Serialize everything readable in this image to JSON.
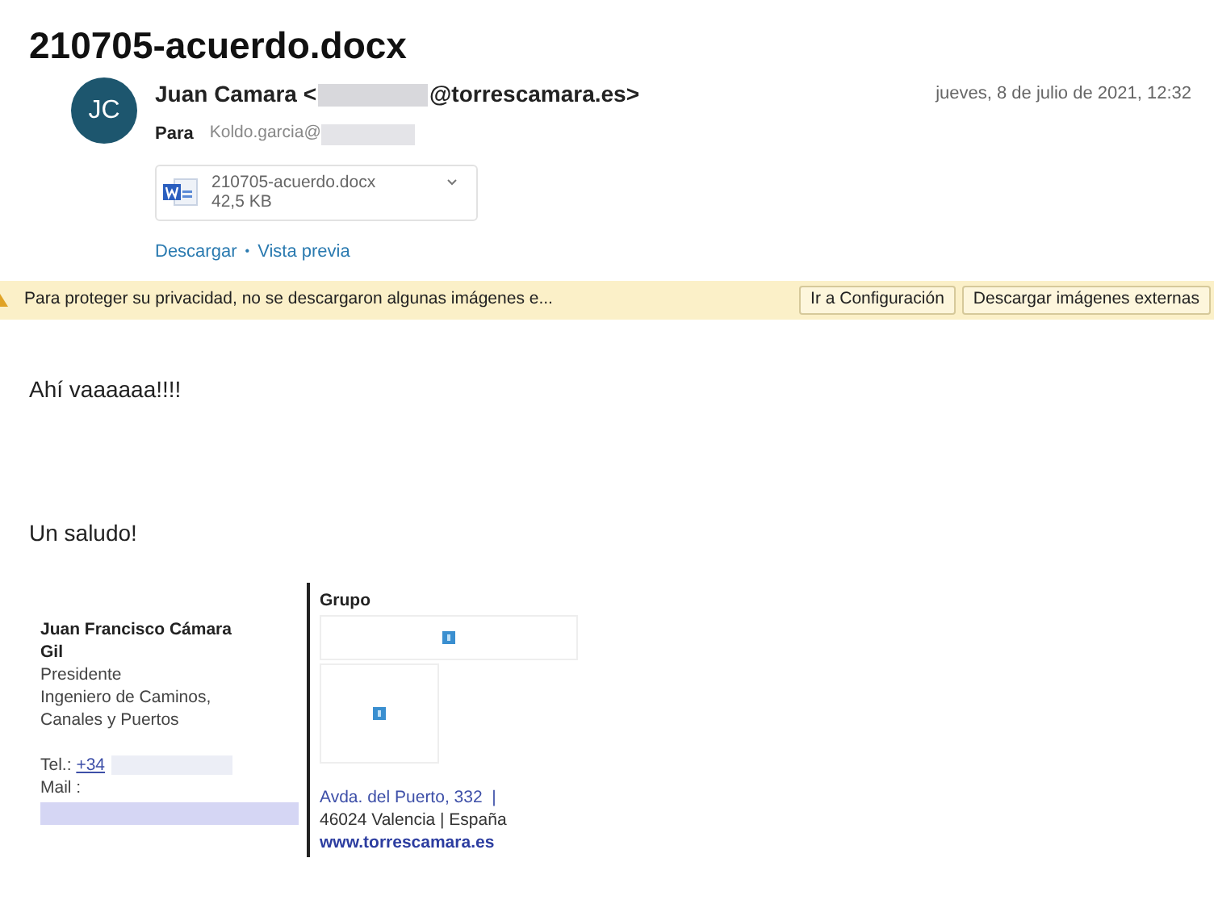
{
  "title": "210705-acuerdo.docx",
  "sender": {
    "initials": "JC",
    "name": "Juan Camara <",
    "email_end": "@torrescamara.es>",
    "date": "jueves, 8 de julio de 2021, 12:32"
  },
  "recipient": {
    "label": "Para",
    "value": "Koldo.garcia@"
  },
  "attachment": {
    "name": "210705-acuerdo.docx",
    "size": "42,5 KB"
  },
  "attachment_actions": [
    {
      "label": "Descargar"
    },
    {
      "label": "Vista previa"
    }
  ],
  "action_separator": "•",
  "banner": {
    "message": "Para proteger su privacidad, no se descargaron algunas imágenes e...",
    "buttons": [
      "Ir a Configuración",
      "Descargar imágenes externas"
    ]
  },
  "body": [
    "Ahí vaaaaaa!!!!",
    "Un saludo!"
  ],
  "signature": {
    "name": "Juan Francisco Cámara Gil",
    "lines": [
      "Presidente",
      "Ingeniero de Caminos,",
      "Canales y Puertos"
    ],
    "phone_label": "Tel.:",
    "phone": "+34",
    "mail_label": "Mail :",
    "group": "Grupo",
    "address": [
      "Avda. del Puerto, 332  |",
      "46024 Valencia | España"
    ],
    "website": "www.torrescamara.es"
  }
}
